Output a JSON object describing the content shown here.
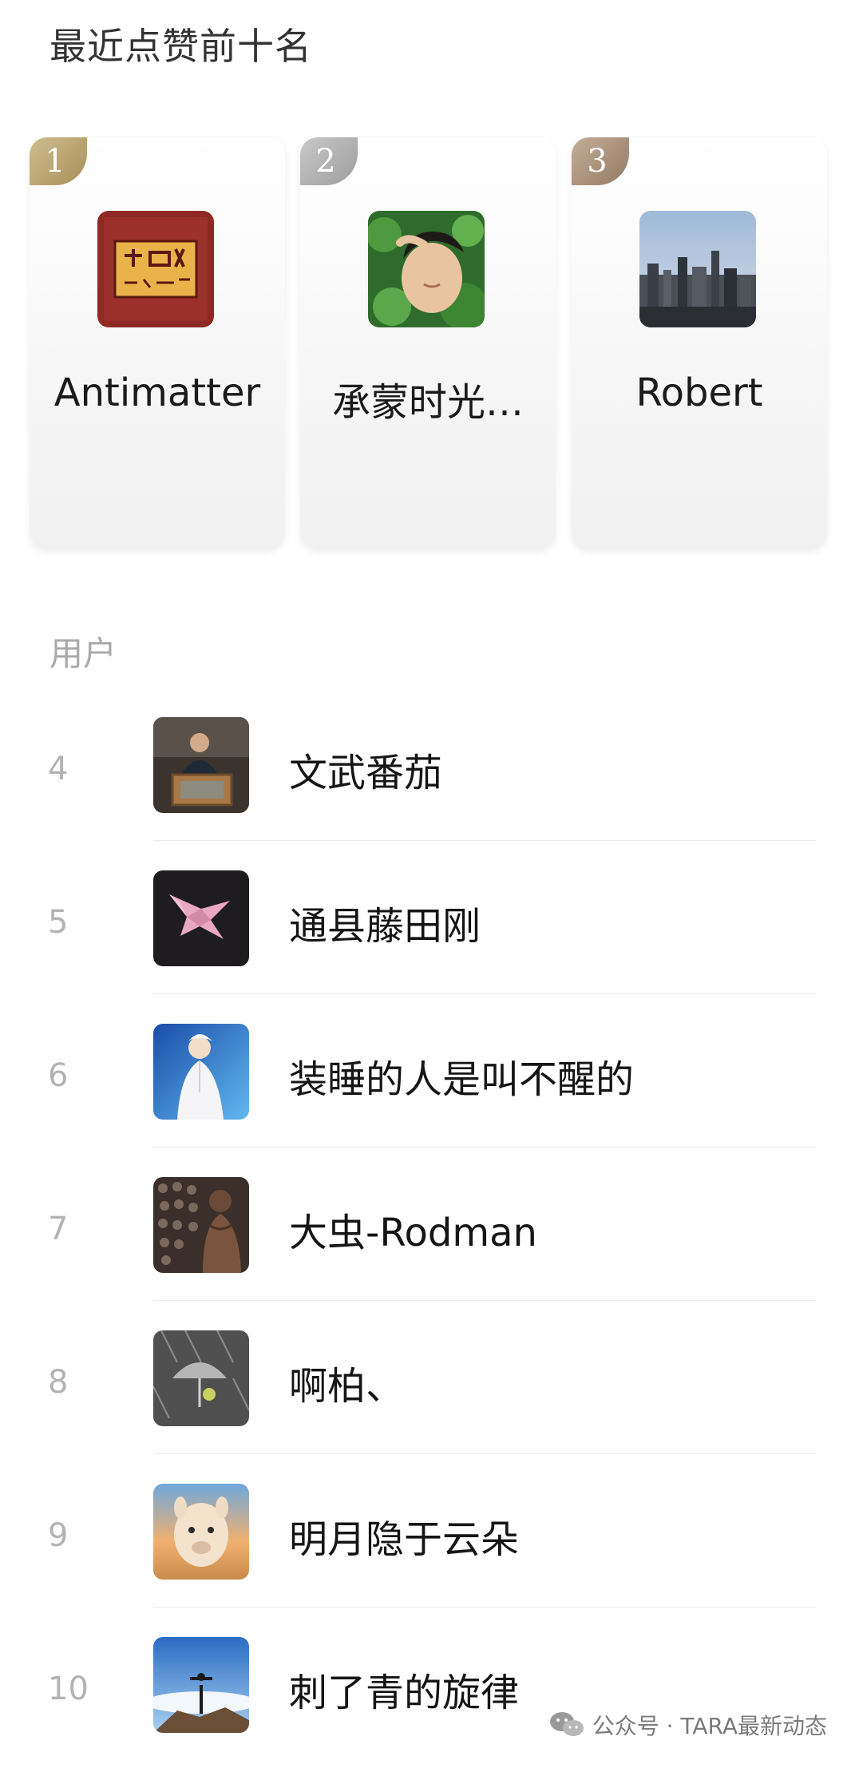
{
  "page": {
    "title": "最近点赞前十名",
    "section_label": "用户",
    "watermark": "公众号 · TARA最新动态"
  },
  "top3": [
    {
      "rank": "1",
      "name": "Antimatter",
      "avatar_icon": "red-calligraphy-avatar-icon"
    },
    {
      "rank": "2",
      "name": "承蒙时光…",
      "avatar_icon": "boy-in-leaves-avatar-icon"
    },
    {
      "rank": "3",
      "name": "Robert",
      "avatar_icon": "city-skyline-avatar-icon"
    }
  ],
  "users": [
    {
      "rank": "4",
      "name": "文武番茄",
      "avatar_icon": "man-at-desk-avatar-icon"
    },
    {
      "rank": "5",
      "name": "通县藤田刚",
      "avatar_icon": "pink-origami-avatar-icon"
    },
    {
      "rank": "6",
      "name": "装睡的人是叫不醒的",
      "avatar_icon": "white-suit-person-avatar-icon"
    },
    {
      "rank": "7",
      "name": "大虫-Rodman",
      "avatar_icon": "basketball-player-avatar-icon"
    },
    {
      "rank": "8",
      "name": "啊柏、",
      "avatar_icon": "umbrella-rain-avatar-icon"
    },
    {
      "rank": "9",
      "name": "明月隐于云朵",
      "avatar_icon": "alpaca-avatar-icon"
    },
    {
      "rank": "10",
      "name": "刺了青的旋律",
      "avatar_icon": "mountain-peak-avatar-icon"
    }
  ],
  "colors": {
    "gold": "#b59c66",
    "silver": "#a8a8a8",
    "bronze": "#a08670",
    "rank_text": "#b3b3b3",
    "section_label": "#aaaaaa"
  }
}
